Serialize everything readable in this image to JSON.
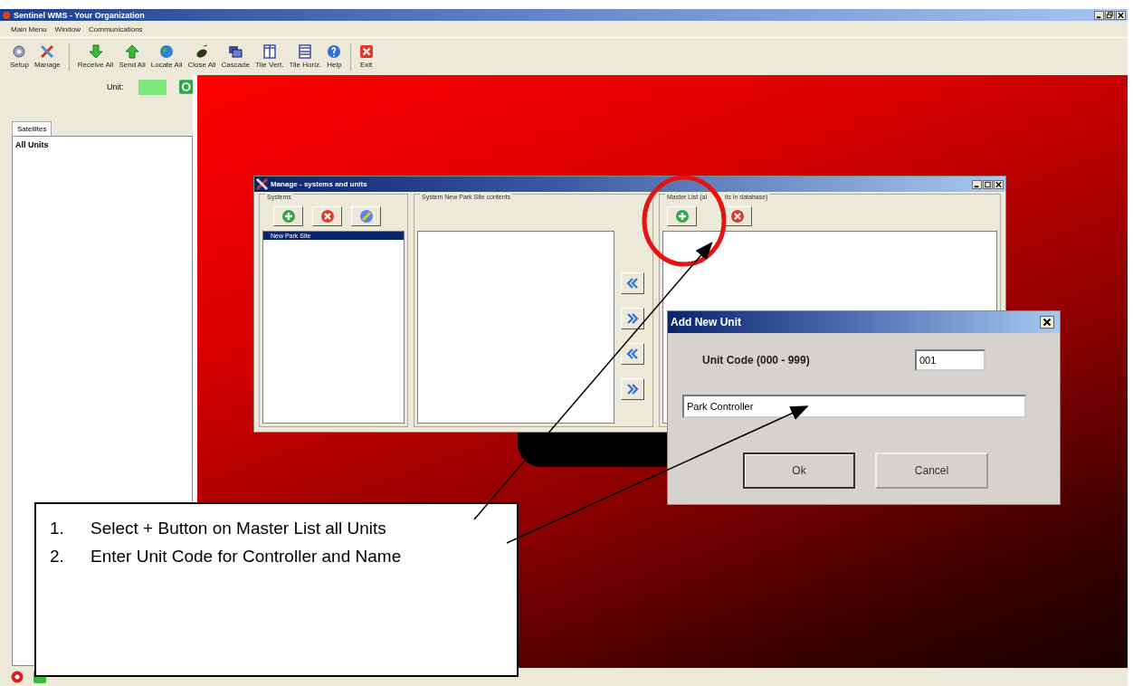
{
  "window": {
    "title": "Sentinel WMS - Your Organization"
  },
  "menu": [
    "Main Menu",
    "Window",
    "Communications"
  ],
  "toolbar": [
    {
      "label": "Setup"
    },
    {
      "label": "Manage"
    },
    {
      "label": "Receive All"
    },
    {
      "label": "Send All"
    },
    {
      "label": "Locate All"
    },
    {
      "label": "Close All"
    },
    {
      "label": "Cascade"
    },
    {
      "label": "Tile Vert."
    },
    {
      "label": "Tile Horiz."
    },
    {
      "label": "Help"
    },
    {
      "label": "Exit"
    }
  ],
  "unit_filter": {
    "label": "Unit:"
  },
  "sidebar": {
    "tabs": [
      {
        "label": "Satellites",
        "selected": true
      }
    ],
    "items": [
      {
        "label": "All Units",
        "selected": false
      }
    ]
  },
  "manage_window": {
    "title": "Manage - systems and units",
    "systems": {
      "title": "Systems",
      "items": [
        {
          "label": "New Park Site",
          "selected": true
        }
      ]
    },
    "contents": {
      "title": "System New Park Site contents"
    },
    "master_list": {
      "title_parts": [
        "Master List (al",
        "its in database)"
      ]
    }
  },
  "dialog": {
    "title": "Add New Unit",
    "unit_code_label": "Unit Code (000 - 999)",
    "unit_code": "001",
    "name": "Park Controller",
    "buttons": [
      "Ok",
      "Cancel"
    ]
  },
  "callout": {
    "steps": [
      {
        "number": "1.",
        "text": "Select + Button on Master List all Units"
      },
      {
        "number": "2.",
        "text": "Enter Unit Code for Controller and Name"
      }
    ]
  }
}
